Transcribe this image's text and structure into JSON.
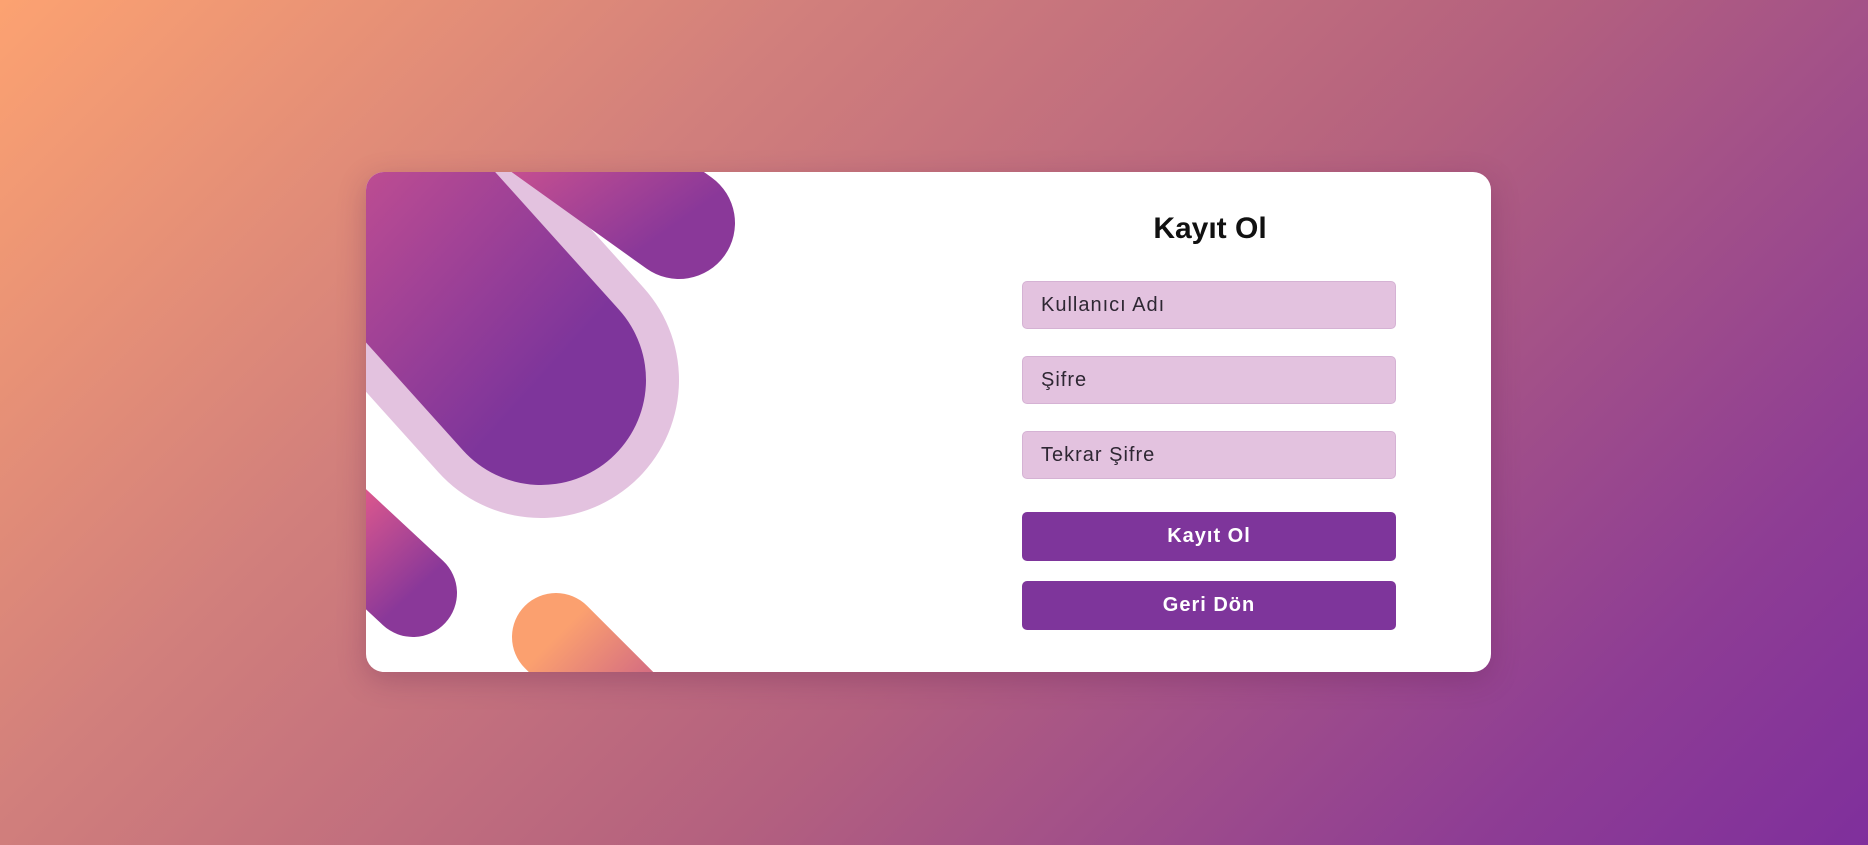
{
  "form": {
    "title": "Kayıt Ol",
    "username_placeholder": "Kullanıcı Adı",
    "password_placeholder": "Şifre",
    "password_repeat_placeholder": "Tekrar Şifre",
    "register_button": "Kayıt Ol",
    "back_button": "Geri Dön"
  },
  "colors": {
    "background_start": "#fca271",
    "background_end": "#7f2f9c",
    "input_background": "#e3c2df",
    "button_background": "#7e359b",
    "decor_pink": "#e05a8e",
    "decor_purple": "#7e359b",
    "decor_lavender": "#e3c2df",
    "decor_orange": "#f9a070"
  }
}
